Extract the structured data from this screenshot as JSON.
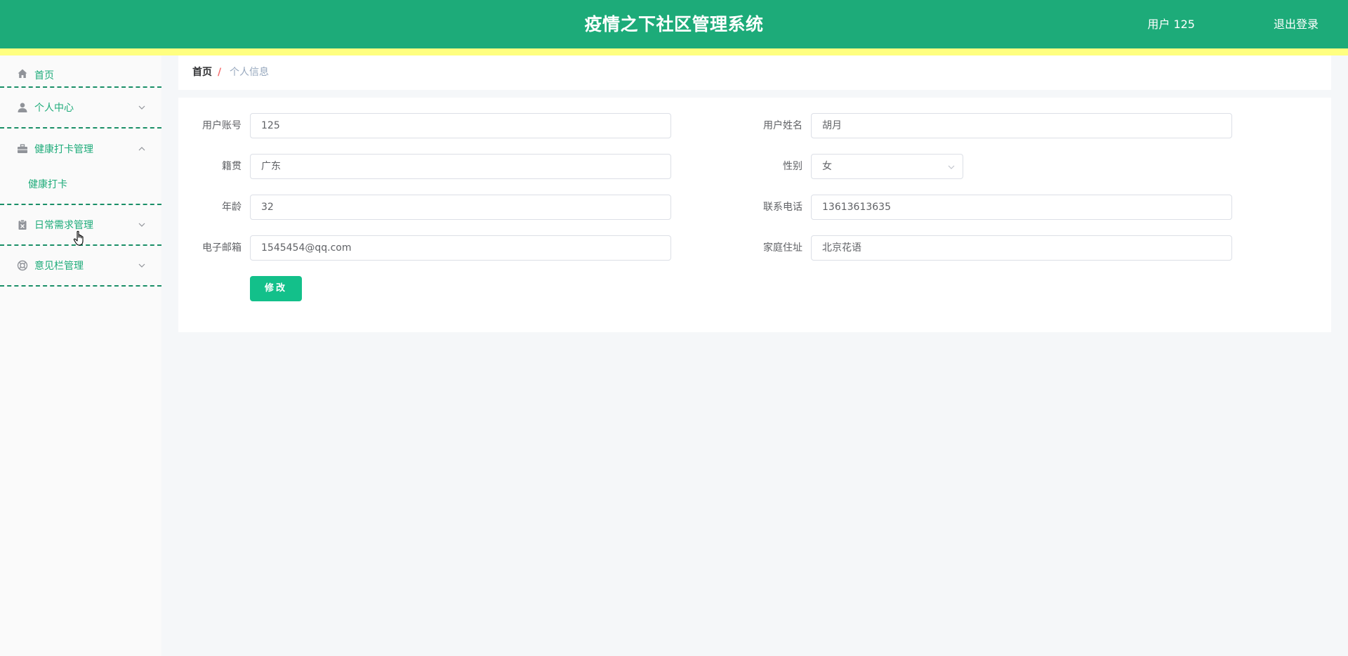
{
  "header": {
    "title": "疫情之下社区管理系统",
    "user_label": "用户 125",
    "logout_label": "退出登录",
    "bg_color": "#1dab79",
    "strip_color": "#ffff80"
  },
  "sidebar": {
    "items": [
      {
        "label": "首页",
        "icon": "home-icon"
      },
      {
        "label": "个人中心",
        "icon": "user-icon",
        "arrow": "chevron-down-icon"
      },
      {
        "label": "健康打卡管理",
        "icon": "briefcase-icon",
        "arrow": "chevron-up-icon",
        "expanded": true,
        "children": [
          {
            "label": "健康打卡"
          }
        ]
      },
      {
        "label": "日常需求管理",
        "icon": "clipboard-icon",
        "arrow": "chevron-down-icon"
      },
      {
        "label": "意见栏管理",
        "icon": "lifebuoy-icon",
        "arrow": "chevron-down-icon"
      }
    ]
  },
  "breadcrumb": {
    "home": "首页",
    "separator": "/",
    "current": "个人信息"
  },
  "form": {
    "fields": {
      "account": {
        "label": "用户账号",
        "value": "125"
      },
      "name": {
        "label": "用户姓名",
        "value": "胡月"
      },
      "origin": {
        "label": "籍贯",
        "value": "广东"
      },
      "gender": {
        "label": "性别",
        "value": "女"
      },
      "age": {
        "label": "年龄",
        "value": "32"
      },
      "phone": {
        "label": "联系电话",
        "value": "13613613635"
      },
      "email": {
        "label": "电子邮箱",
        "value": "1545454@qq.com"
      },
      "address": {
        "label": "家庭住址",
        "value": "北京花语"
      }
    },
    "submit_label": "修改",
    "accent_color": "#13c08a"
  }
}
